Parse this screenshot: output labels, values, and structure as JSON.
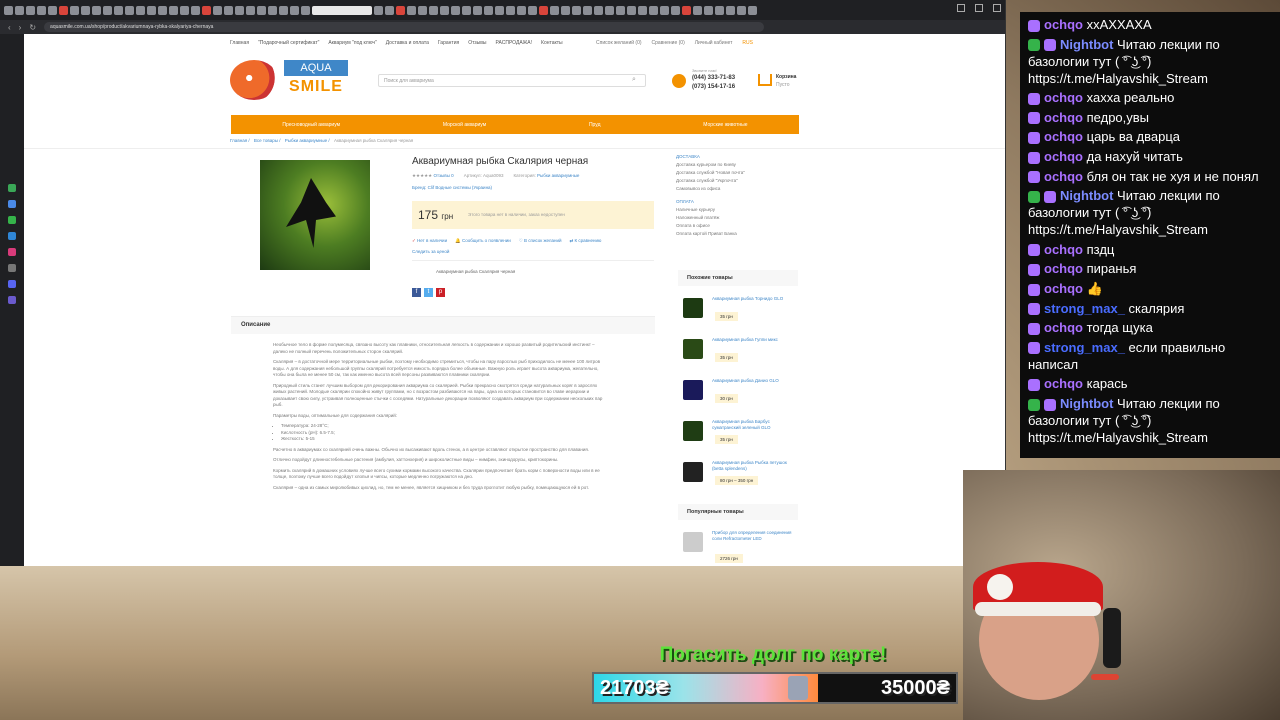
{
  "browser": {
    "url": "aquasmile.com.ua/shop/product/akvariumnaya-rybka-skalyariya-chernaya"
  },
  "site": {
    "topnav": [
      "Главная",
      "\"Подарочный сертификат\"",
      "Аквариум \"под ключ\"",
      "Доставка и оплата",
      "Гарантия",
      "Отзывы",
      "РАСПРОДАЖА!",
      "Контакты"
    ],
    "toplinks": [
      "Список желаний (0)",
      "Сравнение (0)",
      "Личный кабинет",
      "RUS"
    ],
    "logo_top": "AQUA",
    "logo_bottom": "SMILE",
    "search_placeholder": "Поиск для аквариума",
    "phone_label": "Звоните нам!",
    "phone1": "(044) 333-71-83",
    "phone2": "(073) 154-17-16",
    "cart_label": "Корзина",
    "cart_status": "Пусто",
    "menu": [
      "Пресноводный аквариум",
      "Морской аквариум",
      "Пруд",
      "Морские животные"
    ],
    "breadcrumbs": [
      "Главная /",
      "Все товары /",
      "Рыбки аквариумные /",
      "Аквариумная рыбка Скалярия черная"
    ]
  },
  "product": {
    "title": "Аквариумная рыбка Скалярия черная",
    "stars": "★★★★★",
    "reviews": "Отзывы 0",
    "sku": "Артикул: Aqua0093",
    "category_label": "Категория:",
    "category": "Рыбки аквариумные",
    "brand": "Бренд: Сlif Водные системы (Украина)",
    "price": "175",
    "currency": "грн",
    "availability": "Этого товара нет в наличии, заказ недоступен",
    "actions": [
      "Нет в наличии",
      "Сообщить о появлении",
      "В список желаний",
      "К сравнению"
    ],
    "notify": "Следить за ценой",
    "caption": "Аквариумная рыбка Скалярия черная",
    "social": [
      "f",
      "t",
      "p"
    ]
  },
  "description": {
    "tab": "Описание",
    "paragraphs": [
      "Необычное тело в форме полумесяца, связано высоту как плавники, относительная легкость в содержании и хорошо развитый родительский инстинкт – далеко не полный перечень положительных сторон скалярий.",
      "Скалярия – в достаточной мере территориальные рыбки, поэтому необходимо стремиться, чтобы на пару взрослых рыб приходилось не менее 100 литров воды. А для содержания небольшой группы скалярий потребуется емкость порядка более объемные. Важную роль играет высота аквариума, желательно, чтобы она была не менее 50 см, так как именно высота всей персоны развиваются плавники скалярии.",
      "Природный стиль станет лучшим выбором для декорирования аквариума со скалярией. Рыбки прекрасно смотрятся среди натуральных коряг в зарослях живых растений. Молодые скалярии спокойно живут группами, но с возрастом разбиваются на пары, одна из которых становится во главе иерархии и доказывает свою силу, устраивая полноценные стычки с соседями. Натуральные декорации позволяют создавать аквариум при содержании нескольких пар рыб.",
      "Параметры воды, оптимальные для содержания скалярий:"
    ],
    "params": [
      "Температура: 24-28°C;",
      "Кислотность (pH): 6.5-7.5;",
      "Жесткость: 5-15"
    ],
    "paragraphs2": [
      "Расчетно в аквариумах со скалярией очень важны. Обычно их высаживают вдоль стенок, а в центре оставляют открытое пространство для плавания.",
      "Отлично подойдут длинностебельные растения (амбулия, хаттонхерия) и широколистные виды – нимфеи, эхинодорусы, криптокорины.",
      "Кормить скалярий в домашних условиях лучше всего сухими кормами высокого качества. Скалярии предпочитает брать корм с поверхности воды или в ее толще, поэтому лучше всего подойдут хлопья и чипсы, которые медленно погружаются на дно.",
      "Скалярия – одна из самых миролюбивых цихлид, но, тем не менее, является хищником и без труда проглотит любую рыбку, помещающуюся ей в рот."
    ]
  },
  "sidebar": {
    "delivery_title": "ДОСТАВКА",
    "delivery": [
      "Доставка курьером по Киеву",
      "Доставка службой \"Новая почта\"",
      "Доставка службой \"Укрпочта\"",
      "Самовывоз из офиса"
    ],
    "payment_title": "ОПЛАТА",
    "payment": [
      "Наличные курьеру",
      "Наложенный платёж",
      "Оплата в офисе",
      "Оплата картой Приват Банка"
    ],
    "similar_title": "Похожие товары",
    "similar": [
      {
        "name": "Аквариумная рыбка Торнидо GLO",
        "price": "35 грн"
      },
      {
        "name": "Аквариумная рыбка Гуппи микс",
        "price": "35 грн"
      },
      {
        "name": "Аквариумная рыбка Данио GLO",
        "price": "30 грн"
      },
      {
        "name": "Аквариумная рыбка Барбус суматранский зеленый GLO",
        "price": "35 грн"
      },
      {
        "name": "Аквариумная рыбка Рыбка петушок (betta splendens)",
        "price": "80 грн – 350 грн"
      }
    ],
    "popular_title": "Популярные товары",
    "popular": [
      {
        "name": "Прибор для определения соединения соли Refractometer LED",
        "price": "2726 грн"
      }
    ]
  },
  "chat": [
    {
      "user": "ochqo",
      "badges": [
        "sub"
      ],
      "text": "xxAXXAXA"
    },
    {
      "user": "Nightbot",
      "badges": [
        "mod",
        "bot"
      ],
      "text": "Читаю лекции по базологии тут ( ͡° ͜ʖ ͡°) https://t.me/Halyavshik_Stream"
    },
    {
      "user": "ochqo",
      "badges": [
        "sub"
      ],
      "text": "хахха реально"
    },
    {
      "user": "ochqo",
      "badges": [
        "sub"
      ],
      "text": "педро,увы"
    },
    {
      "user": "ochqo",
      "badges": [
        "sub"
      ],
      "text": "царь ва дварца"
    },
    {
      "user": "ochqo",
      "badges": [
        "sub"
      ],
      "text": "да нахуй читать"
    },
    {
      "user": "ochqo",
      "badges": [
        "sub"
      ],
      "text": "бля он так не хуя и не понял"
    },
    {
      "user": "Nightbot",
      "badges": [
        "mod",
        "bot"
      ],
      "text": "Читаю лекции по базологии тут ( ͡° ͜ʖ ͡°) https://t.me/Halyavshik_Stream"
    },
    {
      "user": "ochqo",
      "badges": [
        "sub"
      ],
      "text": "пздц"
    },
    {
      "user": "ochqo",
      "badges": [
        "sub"
      ],
      "text": "пиранья"
    },
    {
      "user": "ochqo",
      "badges": [
        "sub"
      ],
      "text": "👍"
    },
    {
      "user": "strong_max_",
      "badges": [
        "sub"
      ],
      "text": "скалярия"
    },
    {
      "user": "ochqo",
      "badges": [
        "sub"
      ],
      "text": "тогда щука"
    },
    {
      "user": "strong_max_",
      "badges": [
        "sub"
      ],
      "text": "если правильно написал"
    },
    {
      "user": "ochqo",
      "badges": [
        "sub"
      ],
      "text": "карась"
    },
    {
      "user": "Nightbot",
      "badges": [
        "mod",
        "bot"
      ],
      "text": "Читаю лекции по базологии тут ( ͡° ͜ʖ ͡°) https://t.me/Halyavshik_Stream"
    }
  ],
  "donation": {
    "title": "Погасить долг по карте!",
    "current": "21703₴",
    "goal": "35000₴",
    "progress": 0.62
  }
}
